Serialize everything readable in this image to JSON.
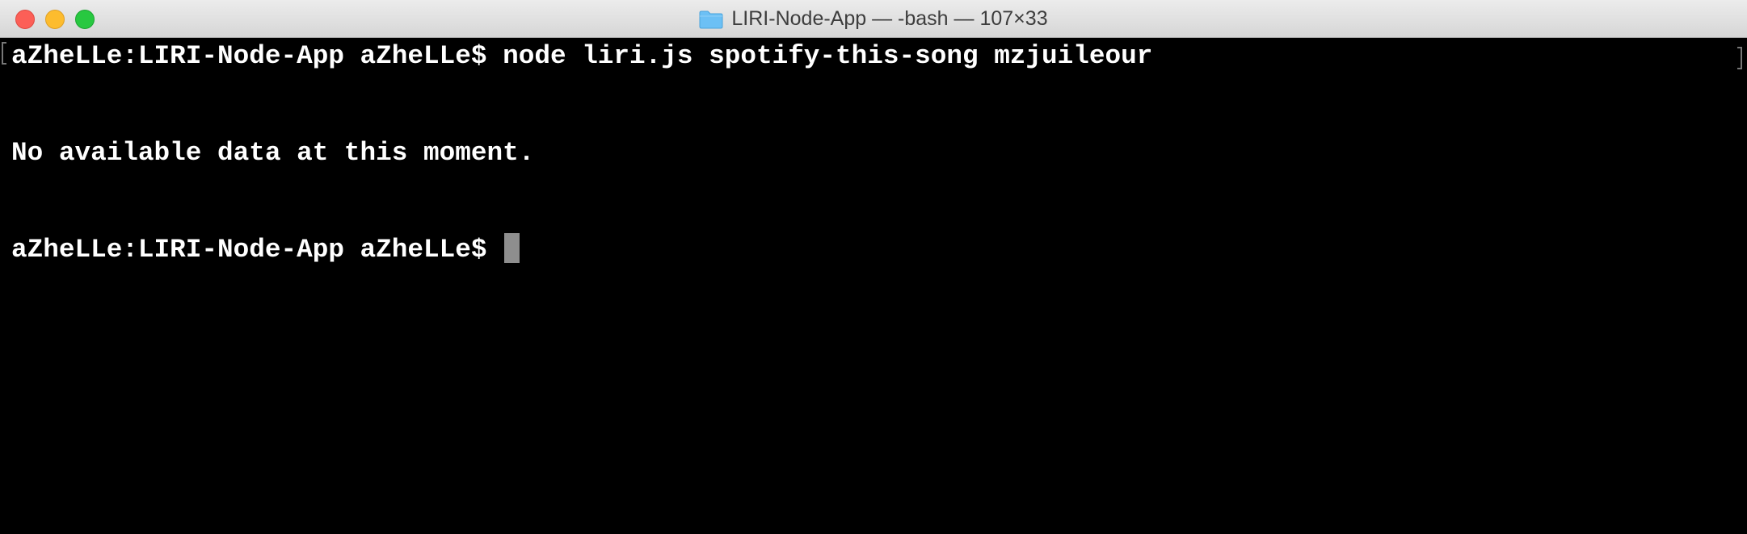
{
  "window": {
    "title": "LIRI-Node-App — -bash — 107×33"
  },
  "terminal": {
    "lines": [
      {
        "prompt": "aZheLLe:LIRI-Node-App aZheLLe$",
        "command": "node liri.js spotify-this-song mzjuileour"
      },
      {
        "text": ""
      },
      {
        "text": "No available data at this moment."
      },
      {
        "text": ""
      },
      {
        "prompt": "aZheLLe:LIRI-Node-App aZheLLe$",
        "command": ""
      }
    ]
  },
  "icons": {
    "folder": "folder-icon",
    "close": "close-icon",
    "minimize": "minimize-icon",
    "zoom": "zoom-icon"
  },
  "colors": {
    "background": "#000000",
    "text": "#ffffff",
    "cursor": "#8e8e8e",
    "close": "#fc5f57",
    "minimize": "#fdbc2e",
    "zoom": "#28c840",
    "folder": "#6cc0f5"
  }
}
